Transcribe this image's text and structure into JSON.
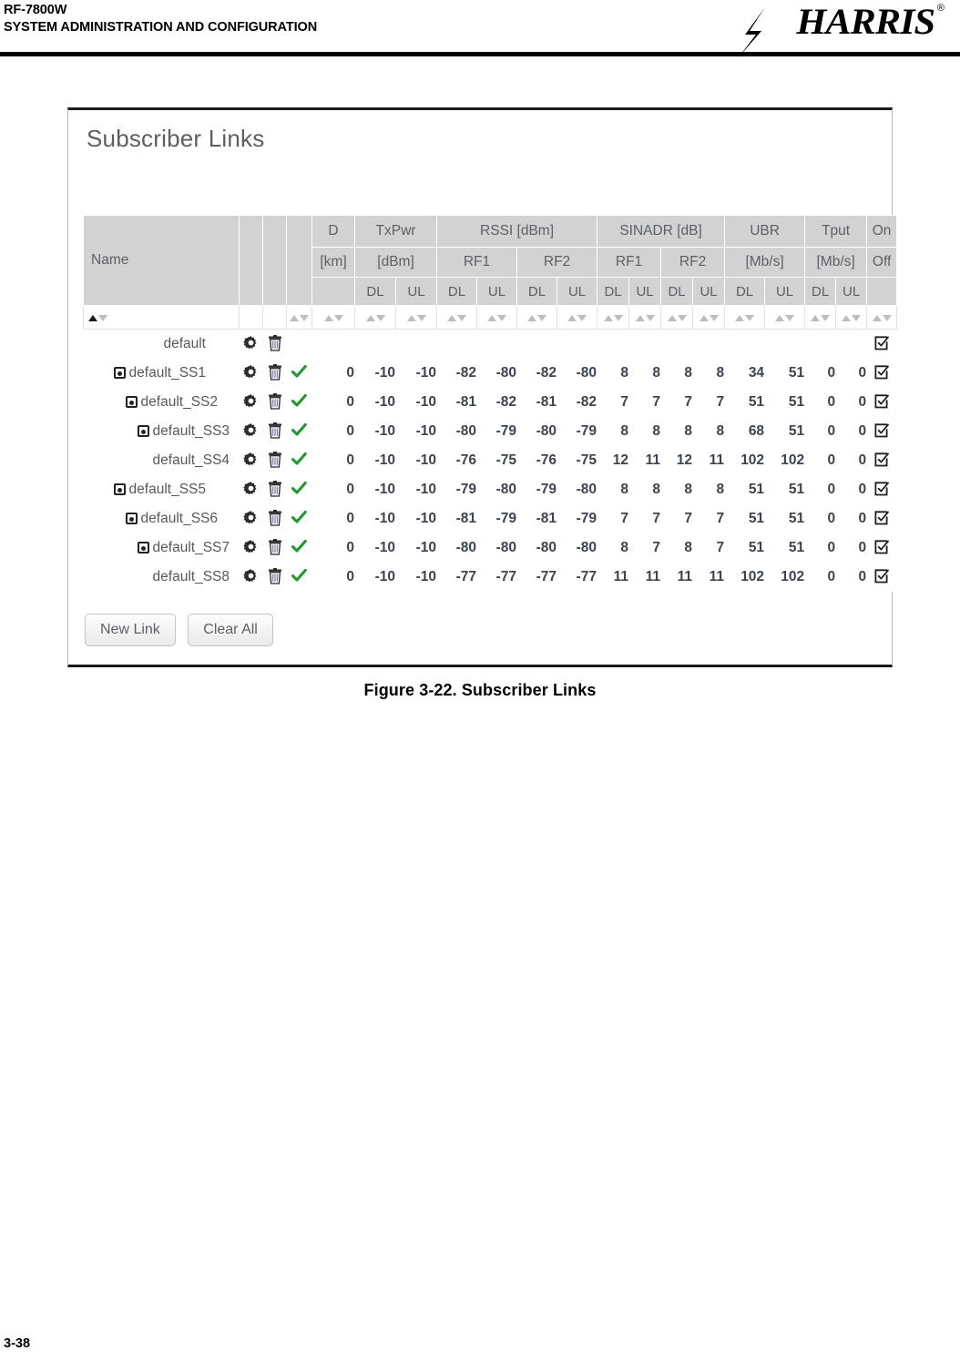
{
  "page": {
    "header_line1": "RF-7800W",
    "header_line2": "SYSTEM ADMINISTRATION AND CONFIGURATION",
    "brand": "HARRIS",
    "brand_registered": "®",
    "footer_page": "3-38",
    "figure_caption": "Figure 3-22.  Subscriber Links"
  },
  "panel": {
    "title": "Subscriber Links",
    "buttons": {
      "new_link": "New Link",
      "clear_all": "Clear All"
    }
  },
  "table": {
    "header": {
      "tier1": {
        "name": "Name",
        "d": "D",
        "txpwr": "TxPwr",
        "rssi": "RSSI [dBm]",
        "sinadr": "SINADR [dB]",
        "ubr": "UBR",
        "tput": "Tput",
        "on": "On"
      },
      "tier2": {
        "d_unit": "[km]",
        "txpwr_unit": "[dBm]",
        "rssi_rf1": "RF1",
        "rssi_rf2": "RF2",
        "sinadr_rf1": "RF1",
        "sinadr_rf2": "RF2",
        "ubr_unit": "[Mb/s]",
        "tput_unit": "[Mb/s]",
        "off": "Off"
      },
      "tier3": {
        "dl": "DL",
        "ul": "UL"
      }
    },
    "columns": [
      "Name",
      "settings",
      "delete",
      "status",
      "D [km]",
      "TxPwr DL",
      "TxPwr UL",
      "RSSI RF1 DL",
      "RSSI RF1 UL",
      "RSSI RF2 DL",
      "RSSI RF2 UL",
      "SINADR RF1 DL",
      "SINADR RF1 UL",
      "SINADR RF2 DL",
      "SINADR RF2 UL",
      "UBR DL",
      "UBR UL",
      "Tput DL",
      "Tput UL",
      "On/Off"
    ],
    "sort": {
      "active_column": "Name",
      "direction": "ascending"
    },
    "rows": [
      {
        "name": "default",
        "indent": 0,
        "expandable": false,
        "status": false,
        "d": "",
        "txpwr_dl": "",
        "txpwr_ul": "",
        "rssi_rf1_dl": "",
        "rssi_rf1_ul": "",
        "rssi_rf2_dl": "",
        "rssi_rf2_ul": "",
        "sinadr_rf1_dl": "",
        "sinadr_rf1_ul": "",
        "sinadr_rf2_dl": "",
        "sinadr_rf2_ul": "",
        "ubr_dl": "",
        "ubr_ul": "",
        "tput_dl": "",
        "tput_ul": "",
        "onoff": true
      },
      {
        "name": "default_SS1",
        "indent": 0,
        "expandable": true,
        "status": true,
        "d": "0",
        "txpwr_dl": "-10",
        "txpwr_ul": "-10",
        "rssi_rf1_dl": "-82",
        "rssi_rf1_ul": "-80",
        "rssi_rf2_dl": "-82",
        "rssi_rf2_ul": "-80",
        "sinadr_rf1_dl": "8",
        "sinadr_rf1_ul": "8",
        "sinadr_rf2_dl": "8",
        "sinadr_rf2_ul": "8",
        "ubr_dl": "34",
        "ubr_ul": "51",
        "tput_dl": "0",
        "tput_ul": "0",
        "onoff": true
      },
      {
        "name": "default_SS2",
        "indent": 1,
        "expandable": true,
        "status": true,
        "d": "0",
        "txpwr_dl": "-10",
        "txpwr_ul": "-10",
        "rssi_rf1_dl": "-81",
        "rssi_rf1_ul": "-82",
        "rssi_rf2_dl": "-81",
        "rssi_rf2_ul": "-82",
        "sinadr_rf1_dl": "7",
        "sinadr_rf1_ul": "7",
        "sinadr_rf2_dl": "7",
        "sinadr_rf2_ul": "7",
        "ubr_dl": "51",
        "ubr_ul": "51",
        "tput_dl": "0",
        "tput_ul": "0",
        "onoff": true
      },
      {
        "name": "default_SS3",
        "indent": 2,
        "expandable": true,
        "status": true,
        "d": "0",
        "txpwr_dl": "-10",
        "txpwr_ul": "-10",
        "rssi_rf1_dl": "-80",
        "rssi_rf1_ul": "-79",
        "rssi_rf2_dl": "-80",
        "rssi_rf2_ul": "-79",
        "sinadr_rf1_dl": "8",
        "sinadr_rf1_ul": "8",
        "sinadr_rf2_dl": "8",
        "sinadr_rf2_ul": "8",
        "ubr_dl": "68",
        "ubr_ul": "51",
        "tput_dl": "0",
        "tput_ul": "0",
        "onoff": true
      },
      {
        "name": "default_SS4",
        "indent": 2,
        "expandable": false,
        "status": true,
        "d": "0",
        "txpwr_dl": "-10",
        "txpwr_ul": "-10",
        "rssi_rf1_dl": "-76",
        "rssi_rf1_ul": "-75",
        "rssi_rf2_dl": "-76",
        "rssi_rf2_ul": "-75",
        "sinadr_rf1_dl": "12",
        "sinadr_rf1_ul": "11",
        "sinadr_rf2_dl": "12",
        "sinadr_rf2_ul": "11",
        "ubr_dl": "102",
        "ubr_ul": "102",
        "tput_dl": "0",
        "tput_ul": "0",
        "onoff": true
      },
      {
        "name": "default_SS5",
        "indent": 0,
        "expandable": true,
        "status": true,
        "d": "0",
        "txpwr_dl": "-10",
        "txpwr_ul": "-10",
        "rssi_rf1_dl": "-79",
        "rssi_rf1_ul": "-80",
        "rssi_rf2_dl": "-79",
        "rssi_rf2_ul": "-80",
        "sinadr_rf1_dl": "8",
        "sinadr_rf1_ul": "8",
        "sinadr_rf2_dl": "8",
        "sinadr_rf2_ul": "8",
        "ubr_dl": "51",
        "ubr_ul": "51",
        "tput_dl": "0",
        "tput_ul": "0",
        "onoff": true
      },
      {
        "name": "default_SS6",
        "indent": 1,
        "expandable": true,
        "status": true,
        "d": "0",
        "txpwr_dl": "-10",
        "txpwr_ul": "-10",
        "rssi_rf1_dl": "-81",
        "rssi_rf1_ul": "-79",
        "rssi_rf2_dl": "-81",
        "rssi_rf2_ul": "-79",
        "sinadr_rf1_dl": "7",
        "sinadr_rf1_ul": "7",
        "sinadr_rf2_dl": "7",
        "sinadr_rf2_ul": "7",
        "ubr_dl": "51",
        "ubr_ul": "51",
        "tput_dl": "0",
        "tput_ul": "0",
        "onoff": true
      },
      {
        "name": "default_SS7",
        "indent": 2,
        "expandable": true,
        "status": true,
        "d": "0",
        "txpwr_dl": "-10",
        "txpwr_ul": "-10",
        "rssi_rf1_dl": "-80",
        "rssi_rf1_ul": "-80",
        "rssi_rf2_dl": "-80",
        "rssi_rf2_ul": "-80",
        "sinadr_rf1_dl": "8",
        "sinadr_rf1_ul": "7",
        "sinadr_rf2_dl": "8",
        "sinadr_rf2_ul": "7",
        "ubr_dl": "51",
        "ubr_ul": "51",
        "tput_dl": "0",
        "tput_ul": "0",
        "onoff": true
      },
      {
        "name": "default_SS8",
        "indent": 2,
        "expandable": false,
        "status": true,
        "d": "0",
        "txpwr_dl": "-10",
        "txpwr_ul": "-10",
        "rssi_rf1_dl": "-77",
        "rssi_rf1_ul": "-77",
        "rssi_rf2_dl": "-77",
        "rssi_rf2_ul": "-77",
        "sinadr_rf1_dl": "11",
        "sinadr_rf1_ul": "11",
        "sinadr_rf2_dl": "11",
        "sinadr_rf2_ul": "11",
        "ubr_dl": "102",
        "ubr_ul": "102",
        "tput_dl": "0",
        "tput_ul": "0",
        "onoff": true
      }
    ]
  },
  "colors": {
    "header_bg": "#d2d2d2",
    "header_text": "#5c6066",
    "data_text": "#3d4450",
    "check_green": "#1a9b2e",
    "panel_border": "#1a1a1a"
  }
}
